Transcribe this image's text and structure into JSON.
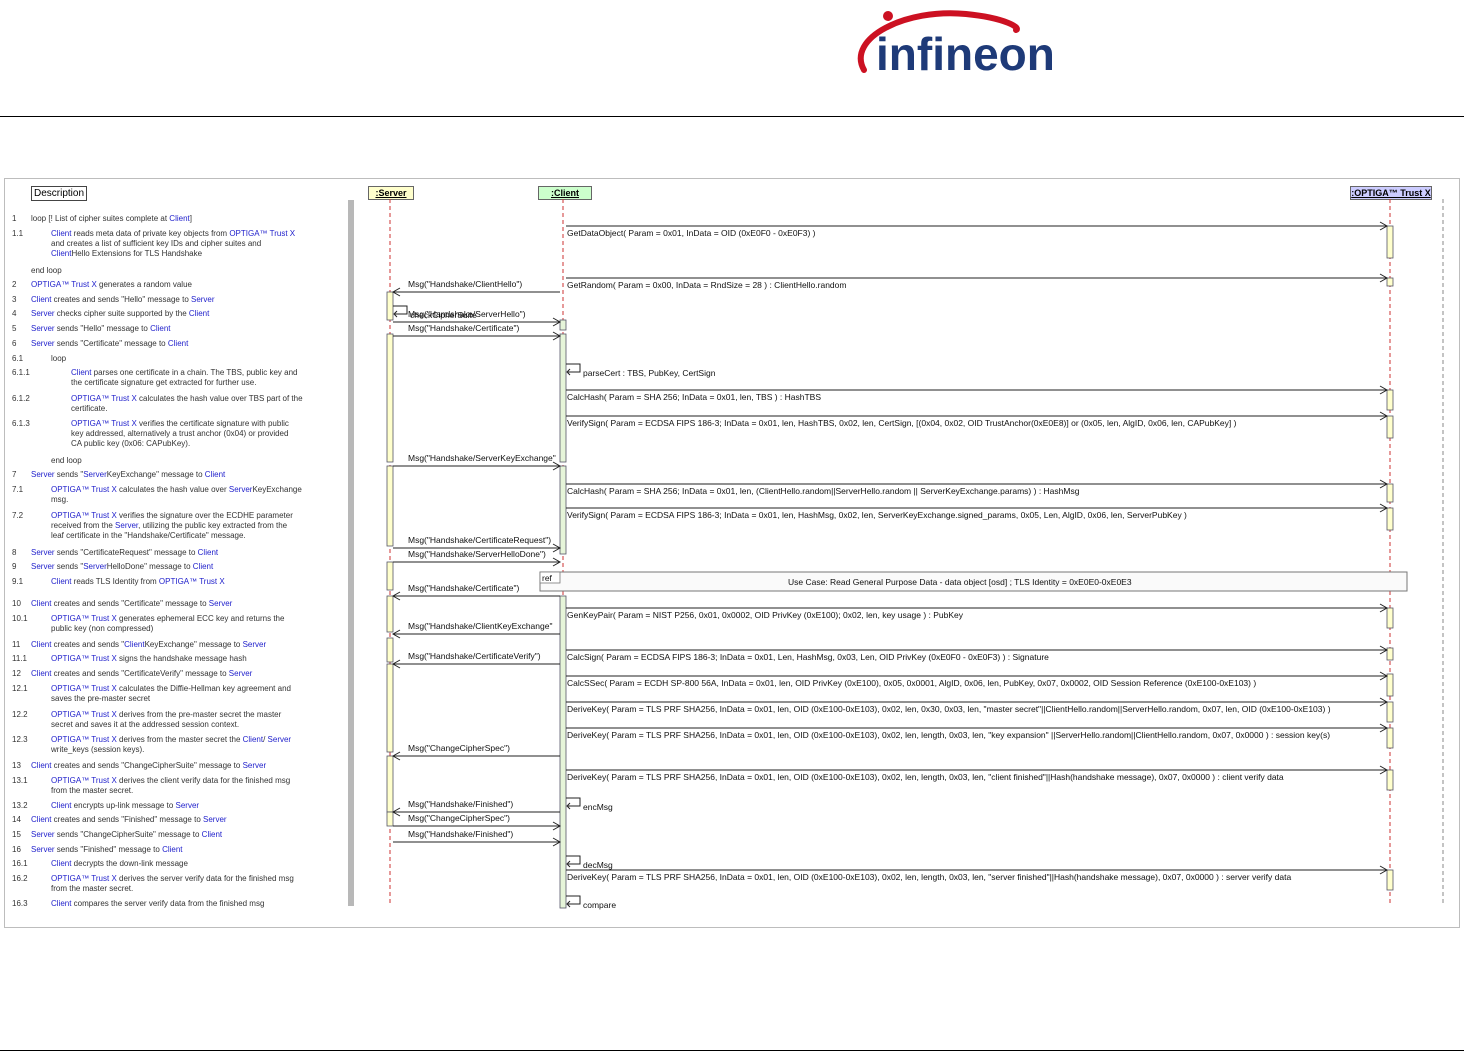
{
  "logo": {
    "text": "infineon",
    "color": "#cc1122",
    "arc_color": "#cc1122",
    "text_color": "#1e3a78"
  },
  "description_header": "Description",
  "lifelines": {
    "server": ":Server",
    "client": ":Client",
    "optiga": ":OPTIGA™ Trust X"
  },
  "steps": [
    {
      "num": "1",
      "text": "loop [! List of cipher suites complete at Client]",
      "indent": 0
    },
    {
      "num": "1.1",
      "text": "Client reads meta data of private key objects from OPTIGA™ Trust X\nand creates a list of sufficient key IDs and cipher suites and\nClientHello Extensions for TLS Handshake",
      "indent": 1
    },
    {
      "num": "",
      "text": "end loop",
      "indent": 0
    },
    {
      "num": "2",
      "text": "OPTIGA™ Trust X generates a random value",
      "indent": 0
    },
    {
      "num": "3",
      "text": "Client creates and sends \"Hello\" message to Server",
      "indent": 0
    },
    {
      "num": "4",
      "text": "Server checks cipher suite supported by the Client",
      "indent": 0
    },
    {
      "num": "5",
      "text": "Server sends \"Hello\" message to Client",
      "indent": 0
    },
    {
      "num": "6",
      "text": "Server sends \"Certificate\" message to Client",
      "indent": 0
    },
    {
      "num": "6.1",
      "text": "loop",
      "indent": 1
    },
    {
      "num": "6.1.1",
      "text": "Client parses one certificate in a chain. The TBS, public key and\nthe certificate signature get extracted for further use.",
      "indent": 2
    },
    {
      "num": "6.1.2",
      "text": "OPTIGA™ Trust X calculates the hash value over TBS part of the\ncertificate.",
      "indent": 2
    },
    {
      "num": "6.1.3",
      "text": "OPTIGA™ Trust X verifies the certificate signature with public\nkey addressed, alternatively a trust anchor (0x04) or provided\nCA public key (0x06: CAPubKey).",
      "indent": 2
    },
    {
      "num": "",
      "text": "end loop",
      "indent": 1
    },
    {
      "num": "7",
      "text": "Server sends \"ServerKeyExchange\" message to Client",
      "indent": 0
    },
    {
      "num": "7.1",
      "text": "OPTIGA™ Trust X calculates the hash value over ServerKeyExchange\nmsg.",
      "indent": 1
    },
    {
      "num": "7.2",
      "text": "OPTIGA™ Trust X verifies the signature over the ECDHE parameter\nreceived from the Server, utilizing the public key extracted from the\nleaf certificate in the \"Handshake/Certificate\" message.",
      "indent": 1
    },
    {
      "num": "8",
      "text": "Server sends \"CertificateRequest\" message to Client",
      "indent": 0
    },
    {
      "num": "9",
      "text": "Server sends \"ServerHelloDone\" message to Client",
      "indent": 0
    },
    {
      "num": "9.1",
      "text": "Client reads TLS Identity from OPTIGA™ Trust X",
      "indent": 1
    },
    {
      "num": "10",
      "text": "Client creates and sends \"Certificate\" message to Server",
      "indent": 0
    },
    {
      "num": "10.1",
      "text": "OPTIGA™ Trust X generates ephemeral ECC key and returns the\npublic key (non compressed)",
      "indent": 1
    },
    {
      "num": "11",
      "text": "Client creates and sends \"ClientKeyExchange\" message to Server",
      "indent": 0
    },
    {
      "num": "11.1",
      "text": "OPTIGA™ Trust X signs the handshake message hash",
      "indent": 1
    },
    {
      "num": "12",
      "text": "Client creates and sends \"CertificateVerify\" message to Server",
      "indent": 0
    },
    {
      "num": "12.1",
      "text": "OPTIGA™ Trust X calculates the Diffie-Hellman key agreement and\nsaves the pre-master secret",
      "indent": 1
    },
    {
      "num": "12.2",
      "text": "OPTIGA™ Trust X derives from the pre-master secret the master\nsecret and saves it at the addressed session context.",
      "indent": 1
    },
    {
      "num": "12.3",
      "text": "OPTIGA™ Trust X derives from the master secret the Client/ Server\nwrite_keys (session keys).",
      "indent": 1
    },
    {
      "num": "13",
      "text": "Client creates and sends \"ChangeCipherSuite\" message to Server",
      "indent": 0
    },
    {
      "num": "13.1",
      "text": "OPTIGA™ Trust X derives the client verify data for the finished msg\nfrom the master secret.",
      "indent": 1
    },
    {
      "num": "13.2",
      "text": "Client encrypts up-link message to Server",
      "indent": 1
    },
    {
      "num": "14",
      "text": "Client creates and sends \"Finished\" message to Server",
      "indent": 0
    },
    {
      "num": "15",
      "text": "Server sends \"ChangeCipherSuite\" message to Client",
      "indent": 0
    },
    {
      "num": "16",
      "text": "Server sends \"Finished\" message to Client",
      "indent": 0
    },
    {
      "num": "16.1",
      "text": "Client decrypts the down-link message",
      "indent": 1
    },
    {
      "num": "16.2",
      "text": "OPTIGA™ Trust X derives the server verify data for the finished msg\nfrom the master secret.",
      "indent": 1
    },
    {
      "num": "16.3",
      "text": "Client compares the server verify data from the finished msg",
      "indent": 1
    }
  ],
  "messages": [
    {
      "from": "client",
      "to": "optiga",
      "label": "GetDataObject( Param = 0x01, InData = OID (0xE0F0 - 0xE0F3) )"
    },
    {
      "from": "client",
      "to": "optiga",
      "label": "GetRandom( Param = 0x00, InData = RndSize = 28 ) : ClientHello.random"
    },
    {
      "from": "client",
      "to": "server",
      "label": "Msg(\"Handshake/ClientHello\")"
    },
    {
      "from": "server",
      "to": "server",
      "label": "checkCipherSuite"
    },
    {
      "from": "server",
      "to": "client",
      "label": "Msg(\"Handshake/ServerHello\")"
    },
    {
      "from": "server",
      "to": "client",
      "label": "Msg(\"Handshake/Certificate\")"
    },
    {
      "from": "client",
      "to": "client",
      "label": "parseCert : TBS, PubKey, CertSign"
    },
    {
      "from": "client",
      "to": "optiga",
      "label": "CalcHash( Param = SHA 256; InData = 0x01, len, TBS ) : HashTBS"
    },
    {
      "from": "client",
      "to": "optiga",
      "label": "VerifySign( Param = ECDSA FIPS 186-3; InData = 0x01, len, HashTBS, 0x02, len, CertSign, [(0x04, 0x02, OID TrustAnchor(0xE0E8)] or (0x05, len, AlgID, 0x06, len, CAPubKey] )"
    },
    {
      "from": "server",
      "to": "client",
      "label": "Msg(\"Handshake/ServerKeyExchange\""
    },
    {
      "from": "client",
      "to": "optiga",
      "label": "CalcHash( Param = SHA 256; InData = 0x01, len, (ClientHello.random||ServerHello.random || ServerKeyExchange.params) ) : HashMsg"
    },
    {
      "from": "client",
      "to": "optiga",
      "label": "VerifySign( Param = ECDSA FIPS 186-3; InData = 0x01, len, HashMsg, 0x02, len, ServerKeyExchange.signed_params, 0x05, Len, AlgID, 0x06, len, ServerPubKey )"
    },
    {
      "from": "server",
      "to": "client",
      "label": "Msg(\"Handshake/CertificateRequest\")"
    },
    {
      "from": "server",
      "to": "client",
      "label": "Msg(\"Handshake/ServerHelloDone\")"
    },
    {
      "from": "client",
      "to": "server",
      "label": "Msg(\"Handshake/Certificate\")"
    },
    {
      "from": "client",
      "to": "optiga",
      "label": "GenKeyPair( Param = NIST P256, 0x01, 0x0002, OID PrivKey (0xE100); 0x02, len, key usage ) : PubKey"
    },
    {
      "from": "client",
      "to": "server",
      "label": "Msg(\"Handshake/ClientKeyExchange\""
    },
    {
      "from": "client",
      "to": "optiga",
      "label": "CalcSign( Param = ECDSA FIPS 186-3; InData = 0x01, Len, HashMsg, 0x03, Len, OID PrivKey (0xE0F0 - 0xE0F3) ) : Signature"
    },
    {
      "from": "client",
      "to": "server",
      "label": "Msg(\"Handshake/CertificateVerify\")"
    },
    {
      "from": "client",
      "to": "optiga",
      "label": "CalcSSec( Param = ECDH SP-800 56A, InData = 0x01, len, OID PrivKey (0xE100), 0x05, 0x0001, AlgID, 0x06, len, PubKey, 0x07, 0x0002, OID Session Reference (0xE100-0xE103) )"
    },
    {
      "from": "client",
      "to": "optiga",
      "label": "DeriveKey( Param = TLS PRF SHA256, InData = 0x01, len, OID (0xE100-0xE103), 0x02, len, 0x30, 0x03, len, \"master secret\"||ClientHello.random||ServerHello.random, 0x07, len, OID (0xE100-0xE103) )"
    },
    {
      "from": "client",
      "to": "optiga",
      "label": "DeriveKey( Param = TLS PRF SHA256, InData = 0x01, len, OID (0xE100-0xE103), 0x02, len, length, 0x03, len, \"key expansion\" ||ServerHello.random||ClientHello.random, 0x07, 0x0000 ) : session key(s)"
    },
    {
      "from": "client",
      "to": "server",
      "label": "Msg(\"ChangeCipherSpec\")"
    },
    {
      "from": "client",
      "to": "optiga",
      "label": "DeriveKey( Param = TLS PRF SHA256, InData = 0x01, len, OID (0xE100-0xE103), 0x02, len, length, 0x03, len, \"client finished\"||Hash(handshake message), 0x07, 0x0000 ) : client verify data"
    },
    {
      "from": "client",
      "to": "client",
      "label": "encMsg"
    },
    {
      "from": "client",
      "to": "server",
      "label": "Msg(\"Handshake/Finished\")"
    },
    {
      "from": "server",
      "to": "client",
      "label": "Msg(\"ChangeCipherSpec\")"
    },
    {
      "from": "server",
      "to": "client",
      "label": "Msg(\"Handshake/Finished\")"
    },
    {
      "from": "client",
      "to": "client",
      "label": "decMsg"
    },
    {
      "from": "client",
      "to": "optiga",
      "label": "DeriveKey( Param = TLS PRF SHA256, InData = 0x01, len, OID (0xE100-0xE103), 0x02, len, length, 0x03, len, \"server finished\"||Hash(handshake message), 0x07, 0x0000 ) : server verify data"
    },
    {
      "from": "client",
      "to": "client",
      "label": "compare"
    }
  ],
  "ref_frame": {
    "tag": "ref",
    "label": "Use Case: Read General Purpose Data - data object [osd] ; TLS Identity = 0xE0E0-0xE0E3"
  },
  "colors": {
    "server_head": "#ffffcc",
    "client_head": "#ccffcc",
    "optiga_head": "#ccccff",
    "activation": "#ffffcc",
    "client_activation": "#e6f5d9",
    "blue_text": "#2222cc"
  }
}
